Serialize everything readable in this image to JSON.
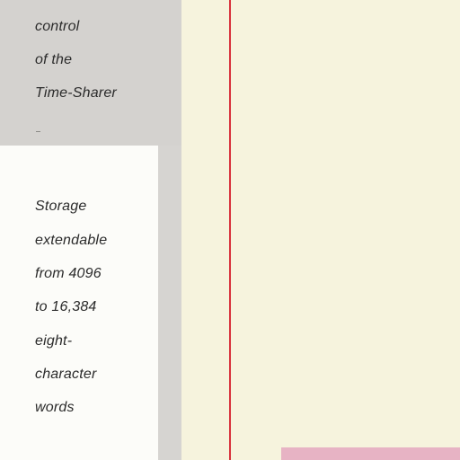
{
  "top_text": [
    "control",
    "of the",
    "Time-Sharer"
  ],
  "card_text": [
    "Storage",
    "extendable",
    "from 4096",
    "to 16,384",
    "eight-",
    "character",
    "words"
  ],
  "colors": {
    "paper": "#f6f3dd",
    "gray_column": "#d6d4d1",
    "card": "#fcfcf9",
    "red_rule": "#d8323d",
    "pink_block": "#e7b3c4",
    "text": "#2b2b2b"
  }
}
